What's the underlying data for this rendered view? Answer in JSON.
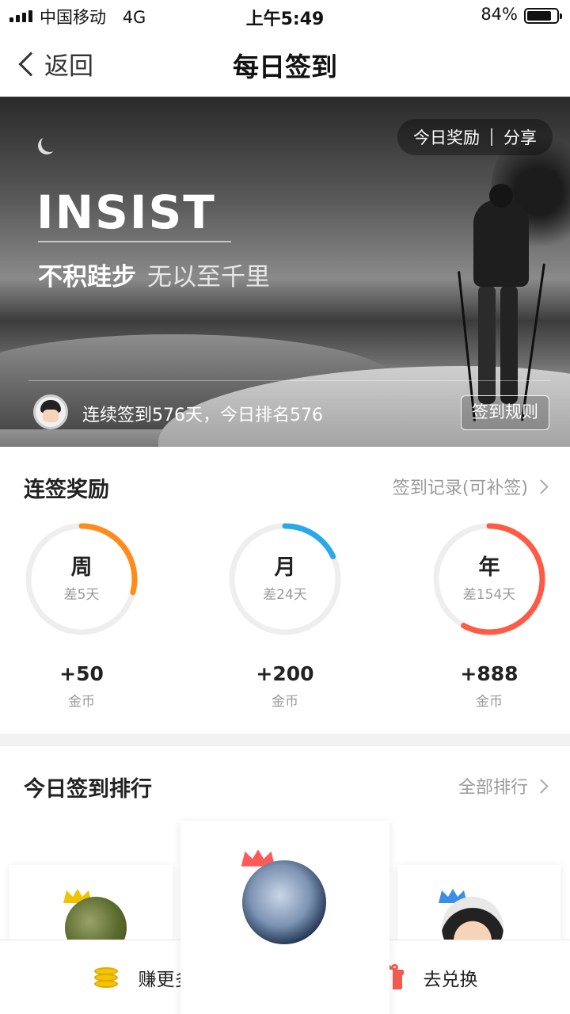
{
  "status_bar": {
    "carrier": "中国移动",
    "network": "4G",
    "time": "上午5:49",
    "battery_percent": "84%",
    "battery_level": 0.84
  },
  "nav": {
    "back_label": "返回",
    "title": "每日签到"
  },
  "hero": {
    "pill_reward": "今日奖励",
    "pill_share": "分享",
    "headline": "INSIST",
    "slogan_bold": "不积跬步",
    "slogan_light": "无以至千里",
    "streak_text": "连续签到576天，今日排名576",
    "rules_button": "签到规则"
  },
  "rewards": {
    "title": "连签奖励",
    "link": "签到记录(可补签)",
    "items": [
      {
        "label": "周",
        "remaining": "差5天",
        "amount": "+50",
        "unit": "金币",
        "progress": 0.29,
        "color": "#ff8c1a"
      },
      {
        "label": "月",
        "remaining": "差24天",
        "amount": "+200",
        "unit": "金币",
        "progress": 0.18,
        "color": "#29a8ea"
      },
      {
        "label": "年",
        "remaining": "差154天",
        "amount": "+888",
        "unit": "金币",
        "progress": 0.58,
        "color": "#ff5a45"
      }
    ]
  },
  "ranking": {
    "title": "今日签到排行",
    "link": "全部排行",
    "crown_colors": [
      "#f2c400",
      "#ff5a5a",
      "#3a8ee6"
    ]
  },
  "bottom_bar": {
    "earn_label": "赚更多",
    "exchange_label": "去兑换"
  }
}
